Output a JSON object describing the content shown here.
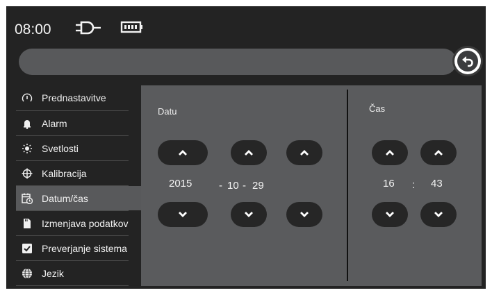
{
  "status": {
    "time": "08:00",
    "plug_icon": "plug-icon",
    "battery_icon": "battery-icon"
  },
  "header": {
    "back_icon": "undo-arrow-icon"
  },
  "sidebar": {
    "items": [
      {
        "label": "Prednastavitve",
        "icon": "gauge-icon"
      },
      {
        "label": "Alarm",
        "icon": "bell-icon"
      },
      {
        "label": "Svetlosti",
        "icon": "brightness-icon"
      },
      {
        "label": "Kalibracija",
        "icon": "crosshair-icon"
      },
      {
        "label": "Datum/čas",
        "icon": "calendar-clock-icon",
        "active": true
      },
      {
        "label": "Izmenjava podatkov",
        "icon": "sd-card-icon"
      },
      {
        "label": "Preverjanje sistema",
        "icon": "checkbox-icon"
      },
      {
        "label": "Jezik",
        "icon": "globe-icon"
      }
    ]
  },
  "date": {
    "label": "Datu",
    "year": "2015",
    "month_sep": "-",
    "month": "10",
    "day_sep": "-",
    "day": "29"
  },
  "time": {
    "label": "Čas",
    "hour": "16",
    "separator": ":",
    "minute": "43"
  },
  "colors": {
    "background": "#232323",
    "panel": "#5a5b5d",
    "active_item": "#58595b",
    "button": "#262626"
  }
}
